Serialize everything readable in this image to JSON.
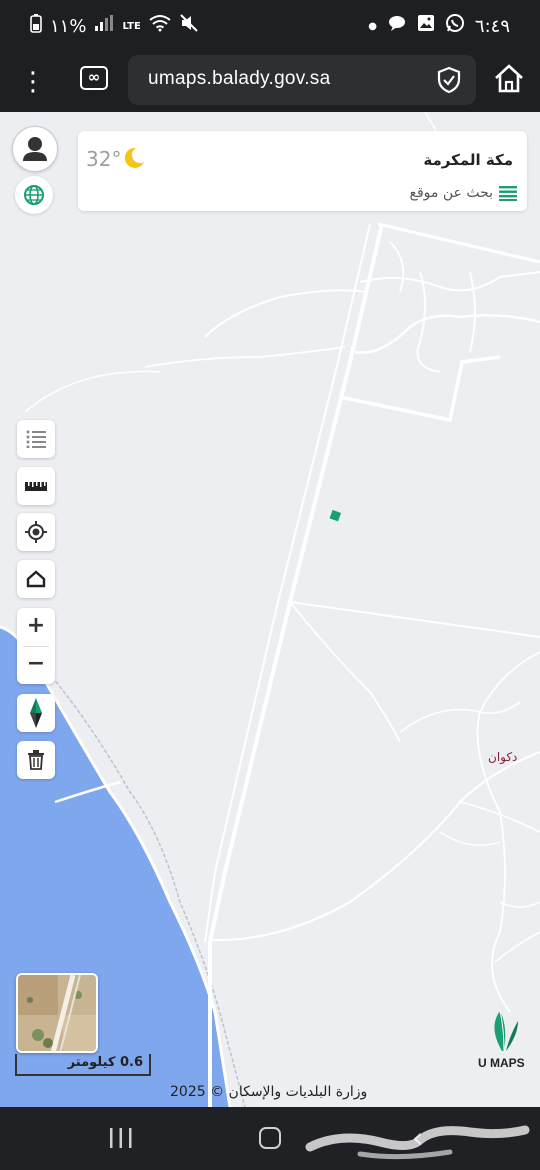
{
  "status_bar": {
    "left_text": "١١%",
    "lte_label": "LTE",
    "time": "٦:٤٩"
  },
  "browser": {
    "url": "umaps.balady.gov.sa"
  },
  "map": {
    "weather": {
      "temperature": "32°"
    },
    "location": {
      "city": "مكة المكرمة",
      "search_placeholder": "بحث عن موقع"
    },
    "zoom_in_label": "+",
    "zoom_out_label": "−",
    "place_label": "دكوان",
    "scale_label": "0.6 كيلومتر",
    "logo_text": "U MAPS",
    "copyright": "وزارة البلديات والإسكان © 2025"
  },
  "colors": {
    "map_background": "#eceef1",
    "sea": "#7fa7ee",
    "road": "#ffffff",
    "accent_green": "#1a9e75",
    "place_label": "#8a2338"
  }
}
